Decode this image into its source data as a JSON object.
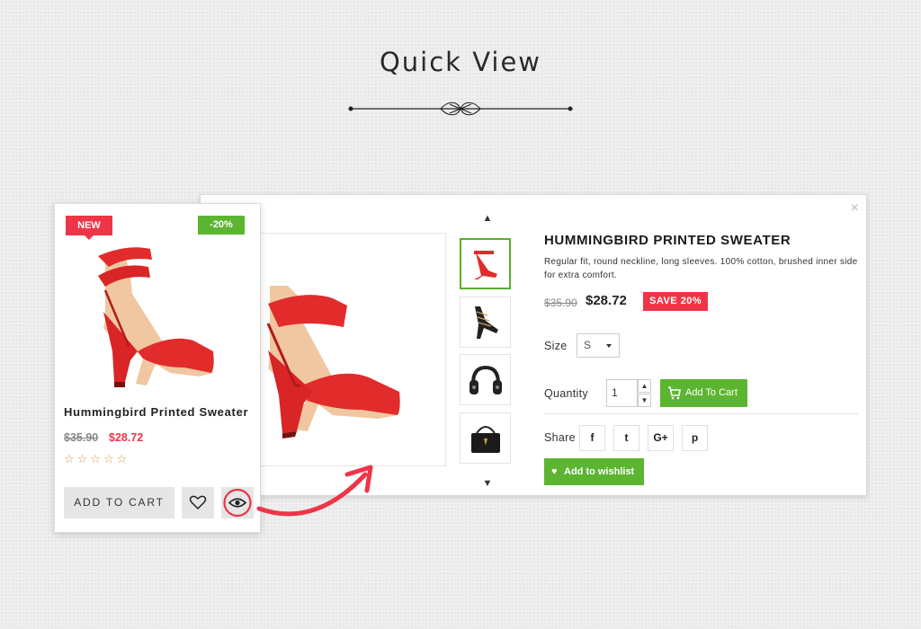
{
  "page": {
    "heading": "Quick View"
  },
  "quick_view": {
    "title": "HUMMINGBIRD PRINTED SWEATER",
    "description": "Regular fit, round neckline, long sleeves. 100% cotton, brushed inner side for extra comfort.",
    "price_old": "$35.90",
    "price_new": "$28.72",
    "save_badge": "SAVE 20%",
    "size_label": "Size",
    "size_value": "S",
    "quantity_label": "Quantity",
    "quantity_value": "1",
    "add_to_cart": "Add To Cart",
    "share_label": "Share",
    "share_icons": [
      {
        "name": "facebook-icon",
        "glyph": "f"
      },
      {
        "name": "twitter-icon",
        "glyph": "t"
      },
      {
        "name": "google-plus-icon",
        "glyph": "G+"
      },
      {
        "name": "pinterest-icon",
        "glyph": "p"
      }
    ],
    "add_to_wishlist": "Add to wishlist",
    "close_glyph": "×",
    "thumbnails": [
      "red-sandal",
      "black-strappy-heel",
      "headphones",
      "black-handbag"
    ]
  },
  "card": {
    "new_badge": "NEW",
    "discount_badge": "-20%",
    "title": "Hummingbird Printed Sweater",
    "price_old": "$35.90",
    "price_new": "$28.72",
    "stars": "☆☆☆☆☆",
    "add_to_cart": "ADD TO CART"
  },
  "colors": {
    "accent_red": "#ee3548",
    "accent_green": "#5cb531"
  }
}
